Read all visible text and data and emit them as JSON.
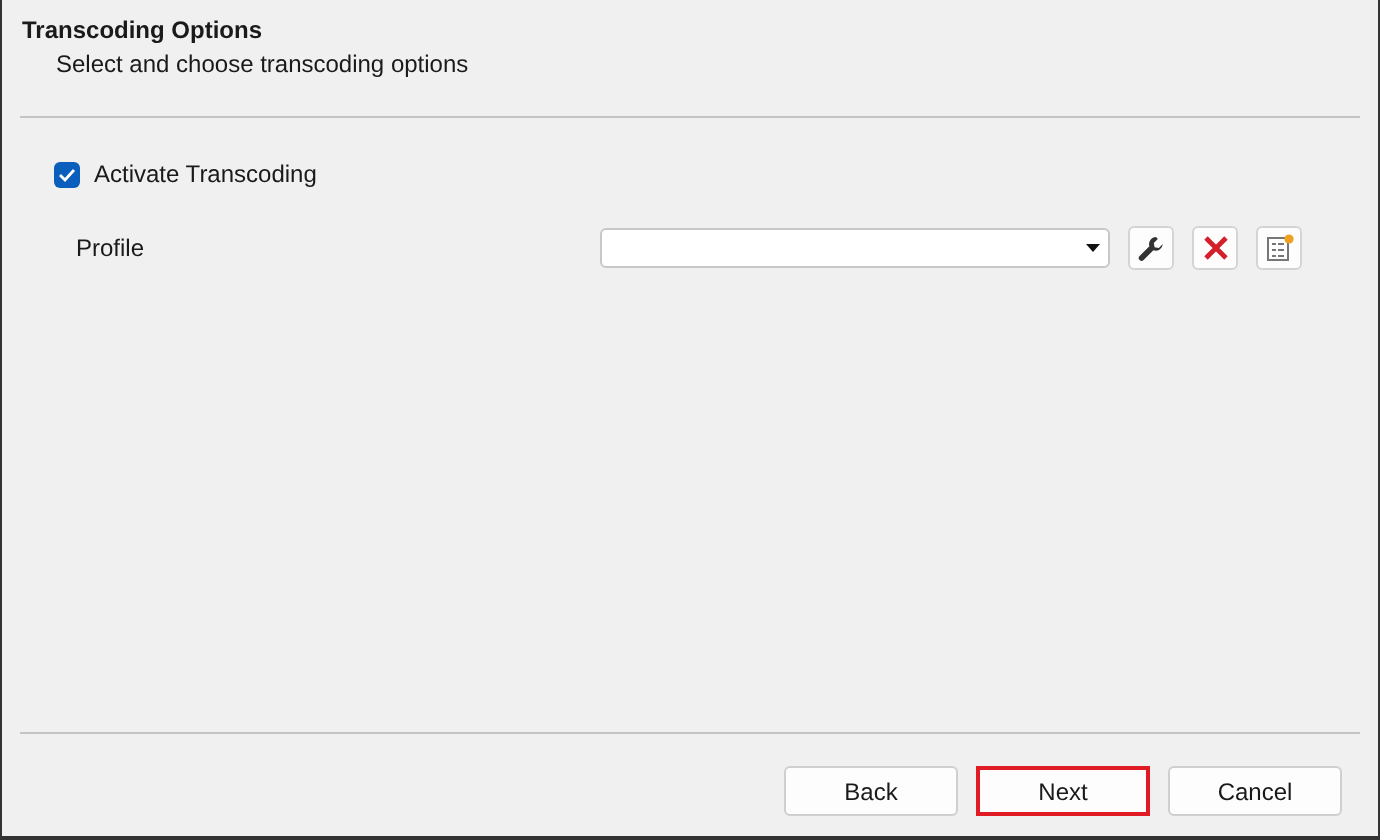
{
  "header": {
    "title": "Transcoding Options",
    "subtitle": "Select and choose transcoding options"
  },
  "activate": {
    "label": "Activate Transcoding",
    "checked": true
  },
  "profile": {
    "label": "Profile"
  },
  "buttons": [
    {
      "label": "Back",
      "highlighted": false
    },
    {
      "label": "Next",
      "highlighted": true
    },
    {
      "label": "Cancel",
      "highlighted": false
    }
  ]
}
